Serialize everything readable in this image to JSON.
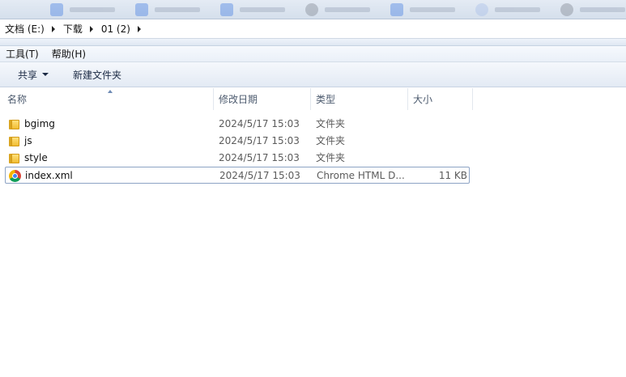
{
  "breadcrumb": {
    "items": [
      "文档 (E:)",
      "下载",
      "01 (2)"
    ]
  },
  "menu": {
    "tools": "工具(T)",
    "help": "帮助(H)"
  },
  "toolbar": {
    "share": "共享",
    "new_folder": "新建文件夹"
  },
  "columns": {
    "name": "名称",
    "modified": "修改日期",
    "type": "类型",
    "size": "大小"
  },
  "files": [
    {
      "name": "bgimg",
      "modified": "2024/5/17 15:03",
      "type": "文件夹",
      "size": "",
      "icon": "folder-icon"
    },
    {
      "name": "js",
      "modified": "2024/5/17 15:03",
      "type": "文件夹",
      "size": "",
      "icon": "folder-icon"
    },
    {
      "name": "style",
      "modified": "2024/5/17 15:03",
      "type": "文件夹",
      "size": "",
      "icon": "folder-icon"
    },
    {
      "name": "index.xml",
      "modified": "2024/5/17 15:03",
      "type": "Chrome HTML D...",
      "size": "11 KB",
      "icon": "chrome-icon"
    }
  ]
}
